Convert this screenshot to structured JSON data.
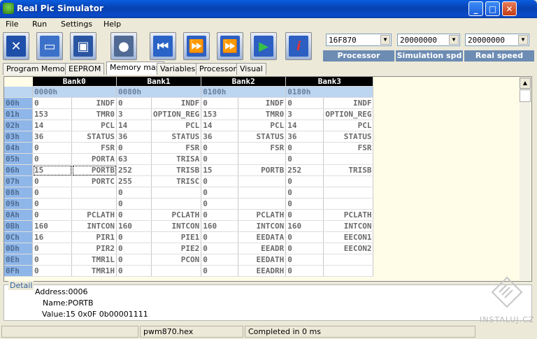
{
  "title": "Real Pic Simulator",
  "menu": [
    "File",
    "Run",
    "Settings",
    "Help"
  ],
  "toolbar": {
    "processor": {
      "value": "16F870",
      "label": "Processor"
    },
    "sim_speed": {
      "value": "20000000",
      "label": "Simulation spd"
    },
    "real_speed": {
      "value": "20000000",
      "label": "Real speed"
    }
  },
  "tabs": [
    "Program Memory",
    "EEPROM",
    "Memory map",
    "Variables",
    "Processor",
    "Visual"
  ],
  "active_tab": "Memory map",
  "banks": [
    {
      "name": "Bank0",
      "addr": "0000h"
    },
    {
      "name": "Bank1",
      "addr": "0080h"
    },
    {
      "name": "Bank2",
      "addr": "0100h"
    },
    {
      "name": "Bank3",
      "addr": "0180h"
    }
  ],
  "rows": [
    {
      "a": "00h",
      "c": [
        [
          "0",
          "INDF"
        ],
        [
          "0",
          "INDF"
        ],
        [
          "0",
          "INDF"
        ],
        [
          "0",
          "INDF"
        ]
      ]
    },
    {
      "a": "01h",
      "c": [
        [
          "153",
          "TMR0"
        ],
        [
          "3",
          "OPTION_REG"
        ],
        [
          "153",
          "TMR0"
        ],
        [
          "3",
          "OPTION_REG"
        ]
      ]
    },
    {
      "a": "02h",
      "c": [
        [
          "14",
          "PCL"
        ],
        [
          "14",
          "PCL"
        ],
        [
          "14",
          "PCL"
        ],
        [
          "14",
          "PCL"
        ]
      ]
    },
    {
      "a": "03h",
      "c": [
        [
          "36",
          "STATUS"
        ],
        [
          "36",
          "STATUS"
        ],
        [
          "36",
          "STATUS"
        ],
        [
          "36",
          "STATUS"
        ]
      ]
    },
    {
      "a": "04h",
      "c": [
        [
          "0",
          "FSR"
        ],
        [
          "0",
          "FSR"
        ],
        [
          "0",
          "FSR"
        ],
        [
          "0",
          "FSR"
        ]
      ]
    },
    {
      "a": "05h",
      "c": [
        [
          "0",
          "PORTA"
        ],
        [
          "63",
          "TRISA"
        ],
        [
          "0",
          ""
        ],
        [
          "0",
          ""
        ]
      ]
    },
    {
      "a": "06h",
      "c": [
        [
          "15",
          "PORTB"
        ],
        [
          "252",
          "TRISB"
        ],
        [
          "15",
          "PORTB"
        ],
        [
          "252",
          "TRISB"
        ]
      ]
    },
    {
      "a": "07h",
      "c": [
        [
          "0",
          "PORTC"
        ],
        [
          "255",
          "TRISC"
        ],
        [
          "0",
          ""
        ],
        [
          "0",
          ""
        ]
      ]
    },
    {
      "a": "08h",
      "c": [
        [
          "0",
          ""
        ],
        [
          "0",
          ""
        ],
        [
          "0",
          ""
        ],
        [
          "0",
          ""
        ]
      ]
    },
    {
      "a": "09h",
      "c": [
        [
          "0",
          ""
        ],
        [
          "0",
          ""
        ],
        [
          "0",
          ""
        ],
        [
          "0",
          ""
        ]
      ]
    },
    {
      "a": "0Ah",
      "c": [
        [
          "0",
          "PCLATH"
        ],
        [
          "0",
          "PCLATH"
        ],
        [
          "0",
          "PCLATH"
        ],
        [
          "0",
          "PCLATH"
        ]
      ]
    },
    {
      "a": "0Bh",
      "c": [
        [
          "160",
          "INTCON"
        ],
        [
          "160",
          "INTCON"
        ],
        [
          "160",
          "INTCON"
        ],
        [
          "160",
          "INTCON"
        ]
      ]
    },
    {
      "a": "0Ch",
      "c": [
        [
          "16",
          "PIR1"
        ],
        [
          "0",
          "PIE1"
        ],
        [
          "0",
          "EEDATA"
        ],
        [
          "0",
          "EECON1"
        ]
      ]
    },
    {
      "a": "0Dh",
      "c": [
        [
          "0",
          "PIR2"
        ],
        [
          "0",
          "PIE2"
        ],
        [
          "0",
          "EEADR"
        ],
        [
          "0",
          "EECON2"
        ]
      ]
    },
    {
      "a": "0Eh",
      "c": [
        [
          "0",
          "TMR1L"
        ],
        [
          "0",
          "PCON"
        ],
        [
          "0",
          "EEDATH"
        ],
        [
          "0",
          ""
        ]
      ]
    },
    {
      "a": "0Fh",
      "c": [
        [
          "0",
          "TMR1H"
        ],
        [
          "0",
          ""
        ],
        [
          "0",
          "EEADRH"
        ],
        [
          "0",
          ""
        ]
      ]
    }
  ],
  "detail": {
    "legend": "Detail",
    "address": "Address:0006",
    "name": "Name:PORTB",
    "value": "Value:15 0x0F 0b00001111"
  },
  "status": {
    "file": "pwm870.hex",
    "message": "Completed in 0 ms"
  },
  "watermark": "INSTALUJ.CZ"
}
